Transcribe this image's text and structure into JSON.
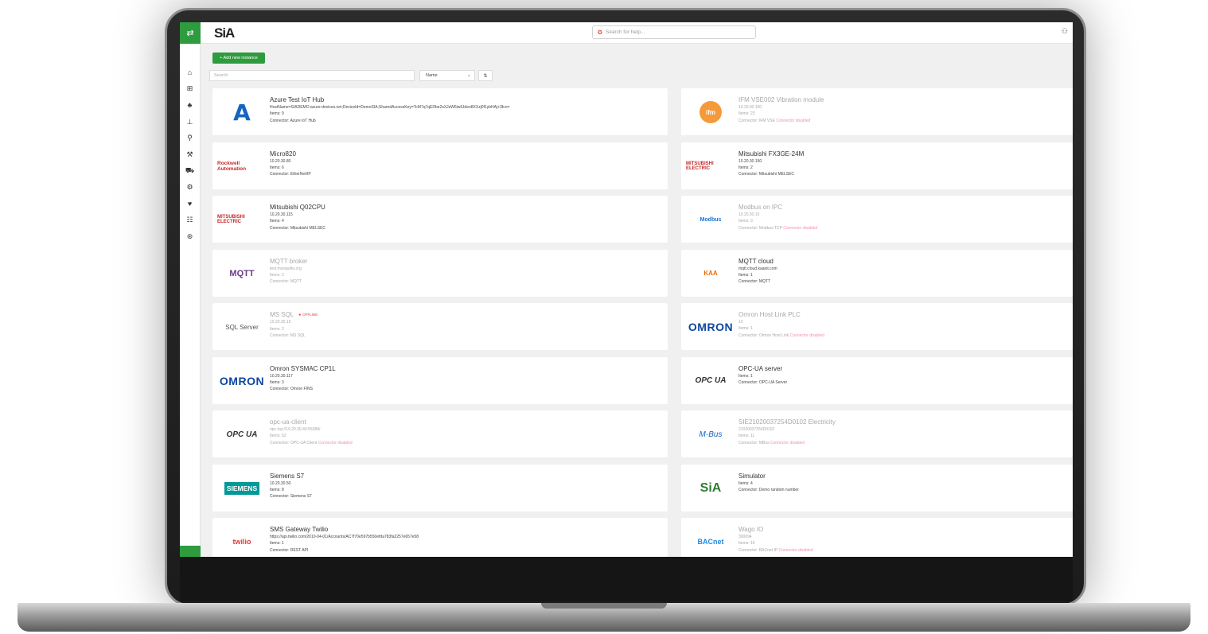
{
  "app": {
    "logo_text": "SiA",
    "help_placeholder": "Search for help...",
    "add_button": "+ Add new instance",
    "search_placeholder": "Search",
    "sort_value": "Name"
  },
  "icons": {
    "sidebar_toggle": "swap-arrows-icon",
    "help": "help-circle-icon",
    "user": "user-icon",
    "nav": [
      "home-icon",
      "dashboard-icon",
      "integrations-icon",
      "network-icon",
      "plug-icon",
      "wrench-icon",
      "pipe-icon",
      "gears-icon",
      "health-icon",
      "users-icon",
      "settings-icon"
    ]
  },
  "colors": {
    "accent": "#2e9b3f",
    "disabled_tag": "#f48fb1",
    "offline": "#e53935"
  },
  "instances": [
    {
      "logo": "A",
      "title": "Azure Test IoT Hub",
      "lines": [
        "HostName=SIADEMO.azure-devices.net;DeviceId=DemoSIA;SharedAccessKey=TcM7q7qEDbe2sXJsW6iwIUdeo8XXzj0f1ybHAj+3fco=",
        "Items: 9",
        "Connector: Azure IoT Hub"
      ],
      "disabled": false
    },
    {
      "logo": "ifm",
      "title": "IFM VSE002 Vibration module",
      "lines": [
        "10.20.30.100",
        "Items: 23",
        "Connector: IFM VSE"
      ],
      "tag": "Connector disabled",
      "disabled": true
    },
    {
      "logo": "Rockwell Automation",
      "title": "Micro820",
      "lines": [
        "10.20.30.80",
        "Items: 6",
        "Connector: EtherNet/IP"
      ],
      "disabled": false
    },
    {
      "logo": "MITSUBISHI ELECTRIC",
      "title": "Mitsubishi FX3GE-24M",
      "lines": [
        "10.20.30.150",
        "Items: 2",
        "Connector: Mitsubishi MELSEC"
      ],
      "disabled": false
    },
    {
      "logo": "MITSUBISHI ELECTRIC",
      "title": "Mitsubishi Q02CPU",
      "lines": [
        "10.20.30.115",
        "Items: 4",
        "Connector: Mitsubishi MELSEC"
      ],
      "disabled": false
    },
    {
      "logo": "Modbus",
      "title": "Modbus on IPC",
      "lines": [
        "10.20.30.15",
        "Items: 3",
        "Connector: Modbus TCP"
      ],
      "tag": "Connector disabled",
      "disabled": true
    },
    {
      "logo": "MQTT",
      "title": "MQTT broker",
      "lines": [
        "test.mosquitto.org",
        "Items: 2",
        "Connector: MQTT"
      ],
      "disabled": true
    },
    {
      "logo": "KAA",
      "title": "MQTT cloud",
      "lines": [
        "mqtt.cloud.kaaiot.com",
        "Items: 1",
        "Connector: MQTT"
      ],
      "disabled": false
    },
    {
      "logo": "SQL Server",
      "title": "MS SQL",
      "badge": "OFFLINE",
      "lines": [
        "10.20.30.15",
        "Items: 2",
        "Connector: MS SQL"
      ],
      "disabled": true
    },
    {
      "logo": "OMRON",
      "title": "Omron Host Link PLC",
      "lines": [
        "12",
        "Items: 1",
        "Connector: Omron Host Link"
      ],
      "tag": "Connector disabled",
      "disabled": true
    },
    {
      "logo": "OMRON",
      "title": "Omron SYSMAC CP1L",
      "lines": [
        "10.20.30.117",
        "Items: 3",
        "Connector: Omron FINS"
      ],
      "disabled": false
    },
    {
      "logo": "OPC UA",
      "title": "OPC-UA server",
      "lines": [
        "Items: 1",
        "Connector: OPC-UA Server"
      ],
      "disabled": false
    },
    {
      "logo": "OPC UA",
      "title": "opc-ua-client",
      "lines": [
        "opc.tcp://10.20.30.40:55388/",
        "Items: 52",
        "Connector: OPC-UA Client"
      ],
      "tag": "Connector disabled",
      "disabled": true
    },
    {
      "logo": "M-Bus",
      "title": "SIE21020037254D0102 Electricity",
      "lines": [
        "21020037254D0102",
        "Items: 11",
        "Connector: MBus"
      ],
      "tag": "Connector disabled",
      "disabled": true
    },
    {
      "logo": "SIEMENS",
      "title": "Siemens S7",
      "lines": [
        "10.20.30.50",
        "Items: 8",
        "Connector: Siemens S7"
      ],
      "disabled": false
    },
    {
      "logo": "SiA",
      "title": "Simulator",
      "lines": [
        "Items: 4",
        "Connector: Demo random number"
      ],
      "disabled": false
    },
    {
      "logo": "twilio",
      "title": "SMS Gateway Twilio",
      "lines": [
        "https://api.twilio.com/2010-04-01/Accounts/AC7f70e597b550efda783fa2257e657e58",
        "Items: 1",
        "Connector: REST API"
      ],
      "disabled": false
    },
    {
      "logo": "BACnet",
      "title": "Wago IO",
      "lines": [
        "390094",
        "Items: 15",
        "Connector: BACnet IP"
      ],
      "tag": "Connector disabled",
      "disabled": true
    }
  ]
}
